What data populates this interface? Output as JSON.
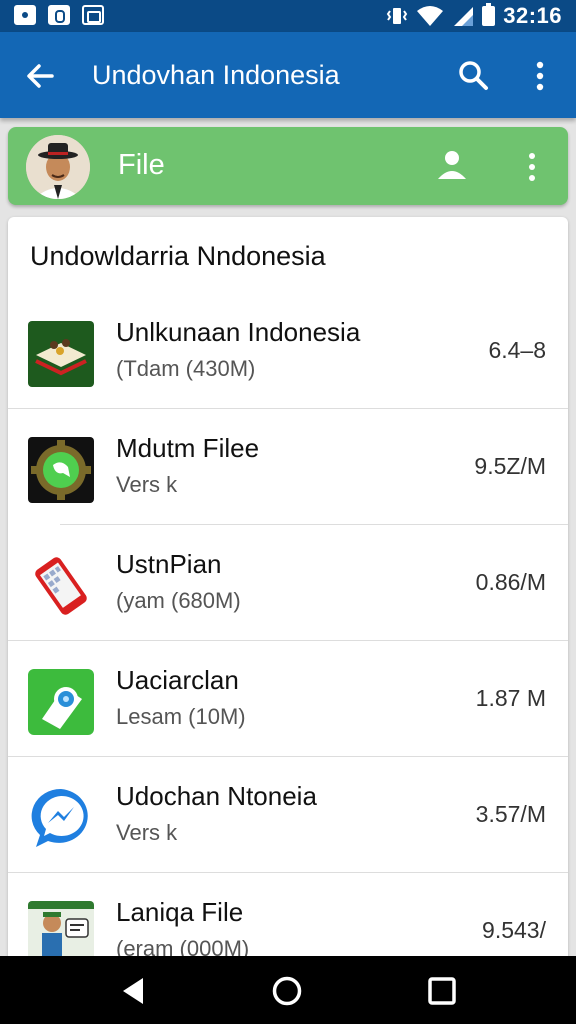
{
  "status_bar": {
    "time": "32:16",
    "icons": [
      "eye-notification-icon",
      "o-notification-icon",
      "image-notification-icon",
      "vibrate-icon",
      "wifi-icon",
      "signal-icon",
      "battery-icon"
    ]
  },
  "app_bar": {
    "title": "Undovhan Indonesia",
    "icons": [
      "back-arrow-icon",
      "search-icon",
      "more-vert-icon"
    ]
  },
  "file_header": {
    "label": "File",
    "icons": [
      "add-person-icon",
      "more-vert-icon"
    ],
    "color": "#6fc36f"
  },
  "list": {
    "title": "Undowldarria Nndonesia",
    "items": [
      {
        "name": "Unlkunaan Indonesia",
        "sub": "(Tdam (430M)",
        "size": "6.4–8",
        "icon": "festival-app-icon"
      },
      {
        "name": "Mdutm Filee",
        "sub": "Vers k",
        "size": "9.5Z/M",
        "icon": "chat-gear-app-icon"
      },
      {
        "name": "UstnPian",
        "sub": "(yam (680M)",
        "size": "0.86/M",
        "icon": "phone-app-icon"
      },
      {
        "name": "Uaciarclan",
        "sub": "Lesam (10M)",
        "size": "1.87 M",
        "icon": "camera-app-icon"
      },
      {
        "name": "Udochan Ntoneia",
        "sub": "Vers k",
        "size": "3.57/M",
        "icon": "messenger-app-icon"
      },
      {
        "name": "Laniqa File",
        "sub": "(eram (000M)",
        "size": "9.543/",
        "icon": "character-app-icon"
      }
    ]
  },
  "nav_bar": {
    "icons": [
      "back-triangle-icon",
      "home-circle-icon",
      "recents-square-icon"
    ]
  },
  "colors": {
    "status_bar": "#0b4a86",
    "app_bar": "#1367b5",
    "nav_bar": "#000000"
  }
}
